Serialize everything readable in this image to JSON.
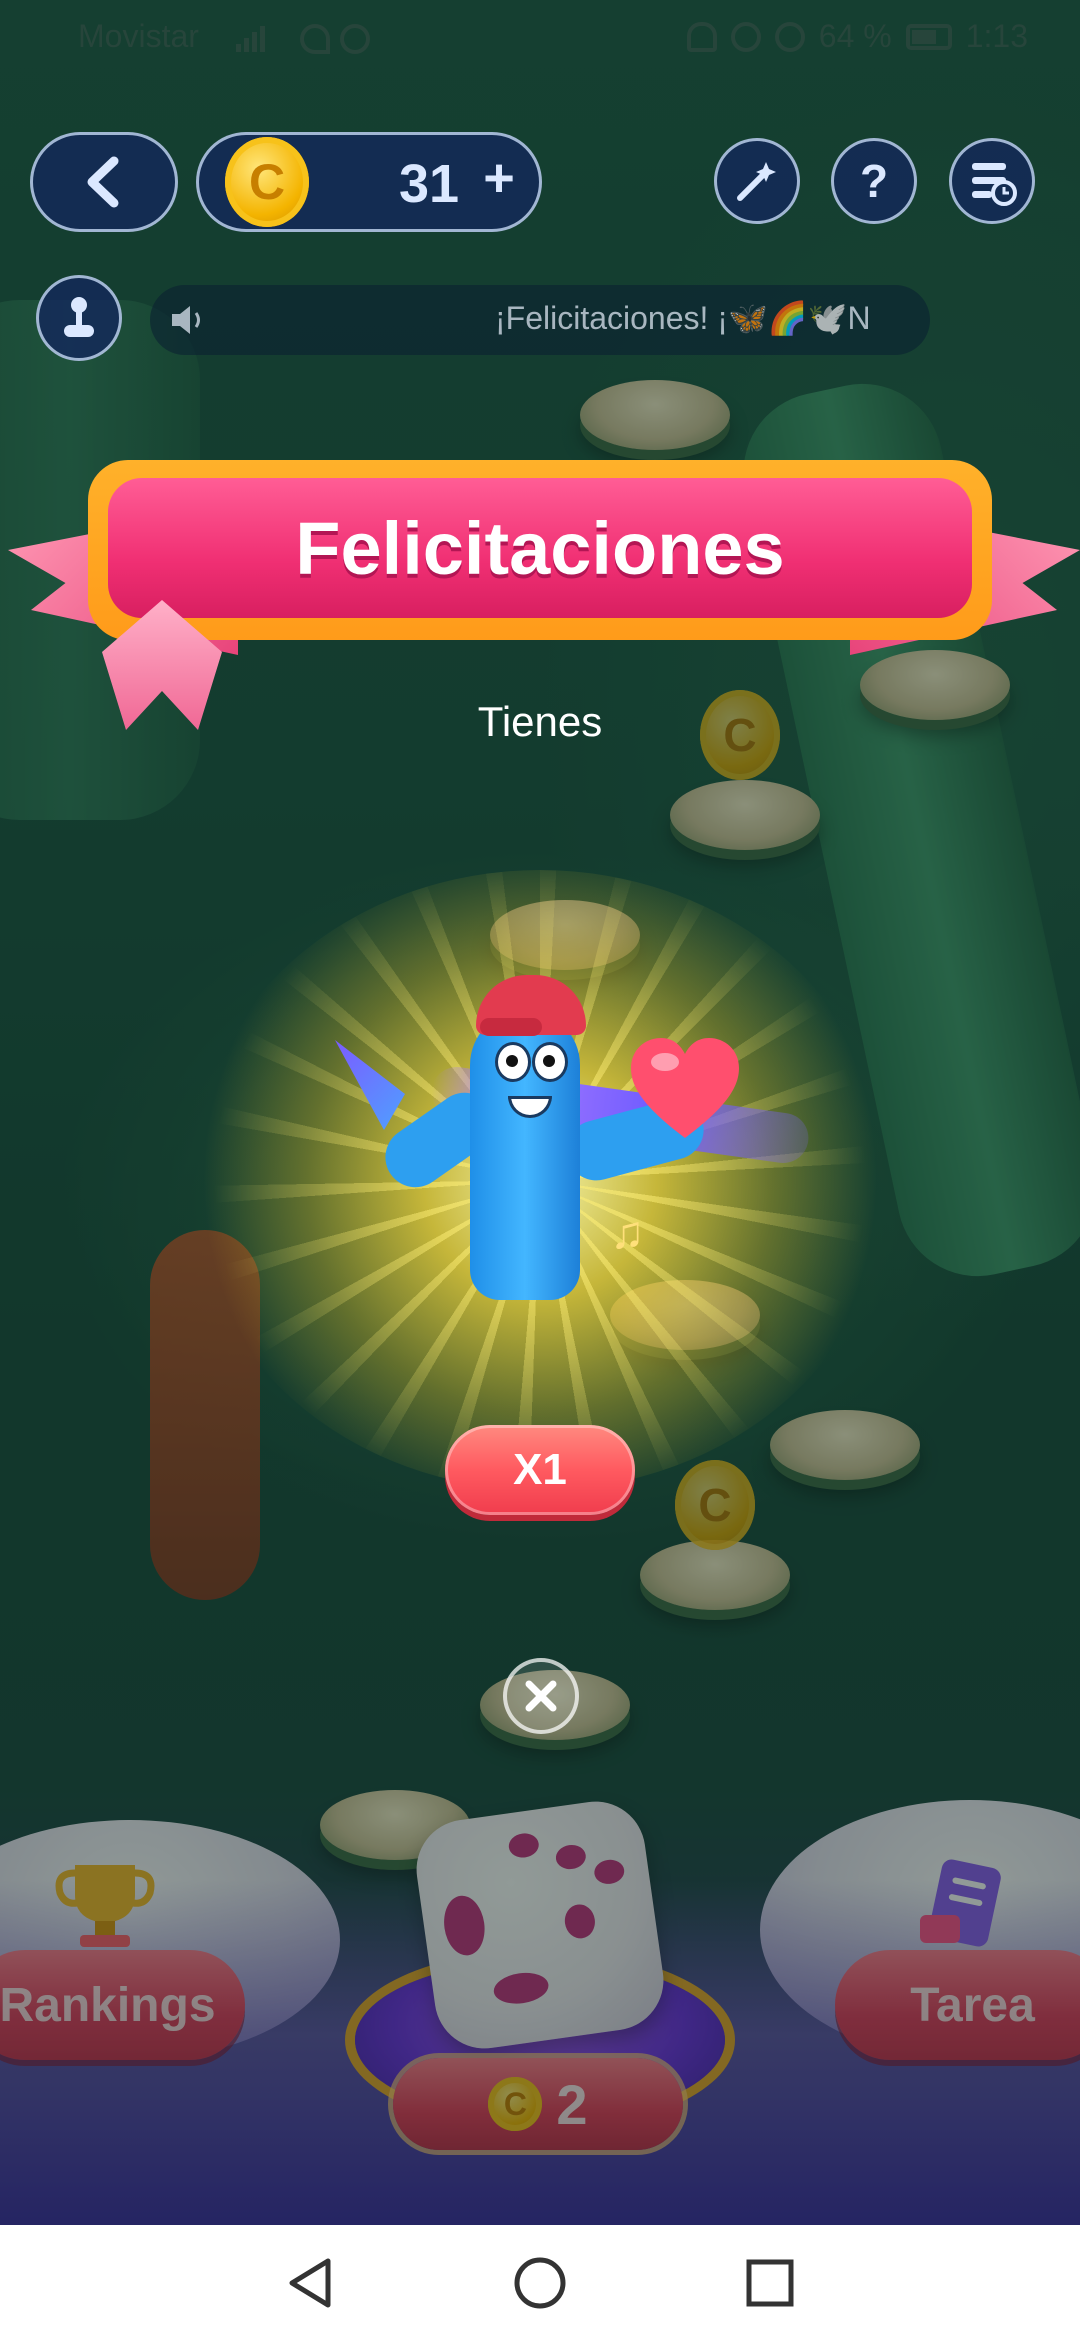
{
  "status_bar": {
    "carrier": "Movistar",
    "battery": "64 %",
    "time": "1:13"
  },
  "top_bar": {
    "coins": "31",
    "coin_symbol": "C",
    "add_label": "+",
    "help_label": "?"
  },
  "ticker": {
    "text": "¡Felicitaciones! ¡🦋🌈🕊️N"
  },
  "popup": {
    "title": "Felicitaciones",
    "subtitle": "Tienes",
    "multiplier": "X1"
  },
  "bottom": {
    "rankings_label": "Rankings",
    "task_label": "Tarea",
    "dice_cost": "2",
    "dice_cost_symbol": "C"
  },
  "icons": {
    "back": "chevron-left-icon",
    "magic": "magic-wand-icon",
    "help": "question-icon",
    "history": "history-icon",
    "music": "music-note-icon",
    "sound": "speaker-icon",
    "close": "close-icon"
  },
  "colors": {
    "banner_pink": "#f02f73",
    "banner_gold": "#ffb12a",
    "multiplier_red": "#ff5a60",
    "panel_navy": "#14285a",
    "mascot_blue": "#43b6ff"
  }
}
